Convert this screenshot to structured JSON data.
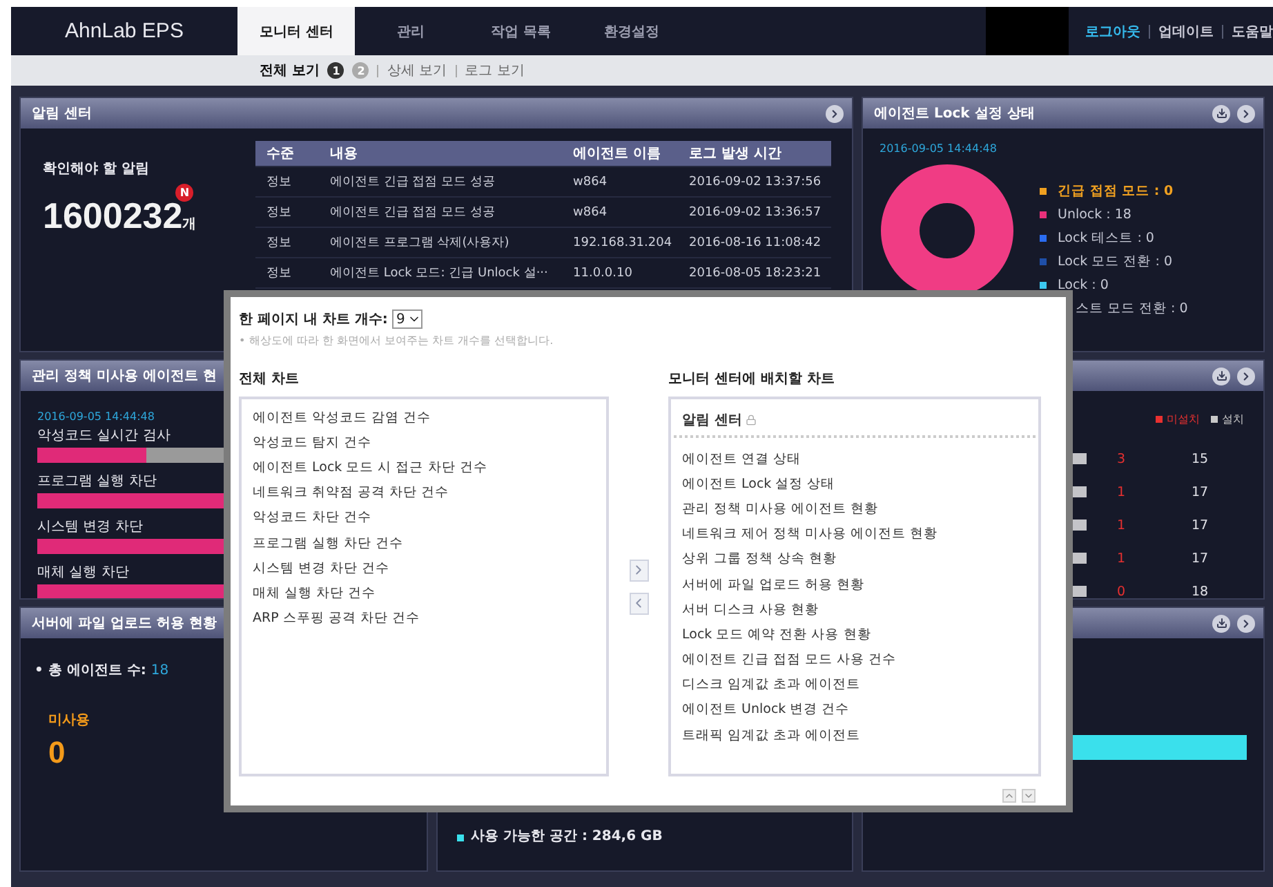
{
  "header": {
    "logo": "AhnLab EPS",
    "tabs": [
      {
        "label": "모니터 센터",
        "selected": true
      },
      {
        "label": "관리",
        "selected": false
      },
      {
        "label": "작업 목록",
        "selected": false
      },
      {
        "label": "환경설정",
        "selected": false
      }
    ],
    "links": [
      {
        "label": "로그아웃",
        "highlighted": true
      },
      {
        "label": "업데이트",
        "highlighted": false
      },
      {
        "label": "도움말",
        "highlighted": false
      }
    ]
  },
  "subnav": {
    "items": [
      {
        "label": "전체 보기",
        "selected": true,
        "pages": [
          {
            "label": "1",
            "selected": true
          },
          {
            "label": "2",
            "selected": false
          }
        ]
      },
      {
        "label": "상세 보기",
        "selected": false
      },
      {
        "label": "로그 보기",
        "selected": false
      }
    ]
  },
  "alarm_panel": {
    "title": "알림 센터",
    "summary_label": "확인해야 할 알림",
    "count": "1600232",
    "new_badge": "N",
    "count_unit": "개",
    "table": {
      "columns": [
        "수준",
        "내용",
        "에이전트 이름",
        "로그 발생 시간"
      ],
      "rows": [
        [
          "정보",
          "에이전트 긴급 접점 모드 성공",
          "w864",
          "2016-09-02 13:37:56"
        ],
        [
          "정보",
          "에이전트 긴급 접점 모드 성공",
          "w864",
          "2016-09-02 13:36:57"
        ],
        [
          "정보",
          "에이전트 프로그램 삭제(사용자)",
          "192.168.31.204",
          "2016-08-16 11:08:42"
        ],
        [
          "정보",
          "에이전트 Lock 모드: 긴급 Unlock 설···",
          "11.0.0.10",
          "2016-08-05 18:23:21"
        ]
      ]
    }
  },
  "lock_panel": {
    "title": "에이전트 Lock 설정 상태",
    "timestamp": "2016-09-05 14:44:48",
    "legend": [
      {
        "label": "긴급 접점 모드 : 0",
        "color": "#f0a020",
        "emphasized": true
      },
      {
        "label": "Unlock : 18",
        "color": "#e8307a",
        "emphasized": false
      },
      {
        "label": "Lock 테스트 : 0",
        "color": "#2a6cf0",
        "emphasized": false
      },
      {
        "label": "Lock 모드 전환 : 0",
        "color": "#1f4fa8",
        "emphasized": false
      },
      {
        "label": "Lock : 0",
        "color": "#3cc8f0",
        "emphasized": false
      },
      {
        "label": "스트 모드 전환 : 0",
        "emphasized": false
      }
    ]
  },
  "policy_panel": {
    "title": "관리 정책 미사용 에이전트 현",
    "timestamp": "2016-09-05 14:44:48",
    "bars": [
      {
        "label": "악성코드 실시간 검사",
        "level": 0.28
      },
      {
        "label": "프로그램 실행 차단",
        "level": 1
      },
      {
        "label": "시스템 변경 차단",
        "level": 1
      },
      {
        "label": "매체 실행 차단",
        "level": 1
      }
    ]
  },
  "install_panel": {
    "legend": [
      {
        "label": "미설치",
        "color": "#e83030"
      },
      {
        "label": "설치",
        "color": "#c8c8c8"
      }
    ],
    "rows": [
      {
        "not_installed": "3",
        "installed": "15"
      },
      {
        "not_installed": "1",
        "installed": "17"
      },
      {
        "not_installed": "1",
        "installed": "17"
      },
      {
        "not_installed": "1",
        "installed": "17"
      },
      {
        "not_installed": "0",
        "installed": "18"
      }
    ]
  },
  "upload_panel": {
    "title": "서버에 파일 업로드 허용 현황",
    "total_label": "• 총 에이전트 수:",
    "total_value": "18",
    "status_label": "미사용",
    "status_value": "0"
  },
  "disk_panel": {
    "free_space": "사용 가능한 공간 : 284,6 GB"
  },
  "modal": {
    "per_page_label": "한 페이지 내 차트 개수:",
    "per_page_value": "9",
    "hint": "• 해상도에 따라 한 화면에서 보여주는 차트 개수를 선택합니다.",
    "all_charts": {
      "title": "전체 차트",
      "items": [
        "에이전트 악성코드 감염 건수",
        "악성코드 탐지 건수",
        "에이전트 Lock 모드 시 접근 차단 건수",
        "네트워크 취약점 공격 차단 건수",
        "악성코드 차단 건수",
        "프로그램 실행 차단 건수",
        "시스템 변경 차단 건수",
        "매체 실행 차단 건수",
        "ARP 스푸핑 공격 차단 건수"
      ]
    },
    "placed_charts": {
      "title": "모니터 센터에 배치할 차트",
      "pinned": "알림 센터",
      "items": [
        "에이전트 연결 상태",
        "에이전트 Lock 설정 상태",
        "관리 정책 미사용 에이전트 현황",
        "네트워크 제어 정책 미사용 에이전트 현황",
        "상위 그룹 정책 상속 현황",
        "서버에 파일 업로드 허용 현황",
        "서버 디스크 사용 현황",
        "Lock 모드 예약 전환 사용 현황",
        "에이전트 긴급 접점 모드 사용 건수",
        "디스크 임계값 초과 에이전트",
        "에이전트 Unlock 변경 건수",
        "트래픽 임계값 초과 에이전트"
      ]
    }
  }
}
